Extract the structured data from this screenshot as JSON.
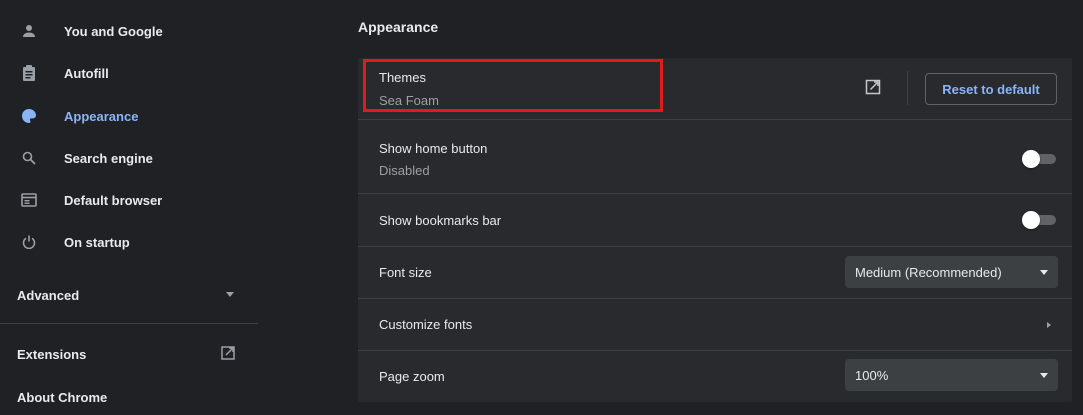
{
  "sidebar": {
    "items": [
      {
        "label": "You and Google",
        "icon": "person-icon"
      },
      {
        "label": "Autofill",
        "icon": "clipboard-icon"
      },
      {
        "label": "Appearance",
        "icon": "palette-icon",
        "active": true
      },
      {
        "label": "Search engine",
        "icon": "search-icon"
      },
      {
        "label": "Default browser",
        "icon": "browser-icon"
      },
      {
        "label": "On startup",
        "icon": "power-icon"
      }
    ],
    "advanced_label": "Advanced",
    "extensions_label": "Extensions",
    "about_label": "About Chrome"
  },
  "main": {
    "section_title": "Appearance",
    "themes": {
      "label": "Themes",
      "value": "Sea Foam",
      "reset_label": "Reset to default"
    },
    "home_button": {
      "label": "Show home button",
      "status": "Disabled",
      "enabled": false
    },
    "bookmarks_bar": {
      "label": "Show bookmarks bar",
      "enabled": false
    },
    "font_size": {
      "label": "Font size",
      "selected": "Medium (Recommended)"
    },
    "customize_fonts": {
      "label": "Customize fonts"
    },
    "page_zoom": {
      "label": "Page zoom",
      "selected": "100%"
    }
  },
  "colors": {
    "background": "#202124",
    "card": "#292a2d",
    "accent": "#8ab4f8",
    "highlight_box": "#e01b1b"
  }
}
